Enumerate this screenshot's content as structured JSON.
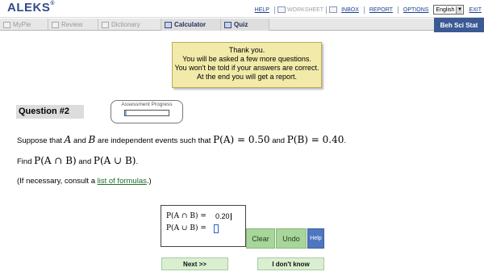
{
  "header": {
    "logo": "ALEKS",
    "logo_mark": "®",
    "links": {
      "help": "HELP",
      "worksheet": "WORKSHEET",
      "inbox": "INBOX",
      "report": "REPORT",
      "options": "OPTIONS",
      "exit": "EXIT"
    },
    "language": "English"
  },
  "tabs": [
    {
      "label": "MyPie"
    },
    {
      "label": "Review"
    },
    {
      "label": "Dictionary"
    },
    {
      "label": "Calculator"
    },
    {
      "label": "Quiz"
    }
  ],
  "course": "Beh Sci Stat",
  "notice": {
    "line1": "Thank you.",
    "line2": "You will be asked a few more questions.",
    "line3": "You won't be told if your answers are correct.",
    "line4": "At the end you will get a report."
  },
  "question": {
    "title": "Question #2",
    "text_1": "Suppose that",
    "var_a": "A",
    "text_and": "and",
    "var_b": "B",
    "text_2": "are independent events such that",
    "p_abar": "P(A) = 0.50",
    "text_and2": "and",
    "p_b": "P(B) = 0.40",
    "period": ".",
    "find": "Find",
    "find_1": "P(A ∩ B)",
    "find_and": "and",
    "find_2": "P(A ∪ B)",
    "find_period": ".",
    "consult_pre": "(If necessary, consult a",
    "consult_link": "list of formulas",
    "consult_post": ".)"
  },
  "progress": {
    "label": "Assessment Progress",
    "value": 0.03
  },
  "answers": {
    "row1_label": "P(A ∩ B) =",
    "row1_value": "0.20",
    "row2_label": "P(A ∪ B) ="
  },
  "buttons": {
    "clear": "Clear",
    "undo": "Undo",
    "help": "Help",
    "next": "Next >>",
    "idk": "I don't know"
  },
  "colors": {
    "brand": "#2f4d8a",
    "notice_bg": "#f1eaa9",
    "button_green": "#a8d69a",
    "help_blue": "#4e77c0"
  }
}
